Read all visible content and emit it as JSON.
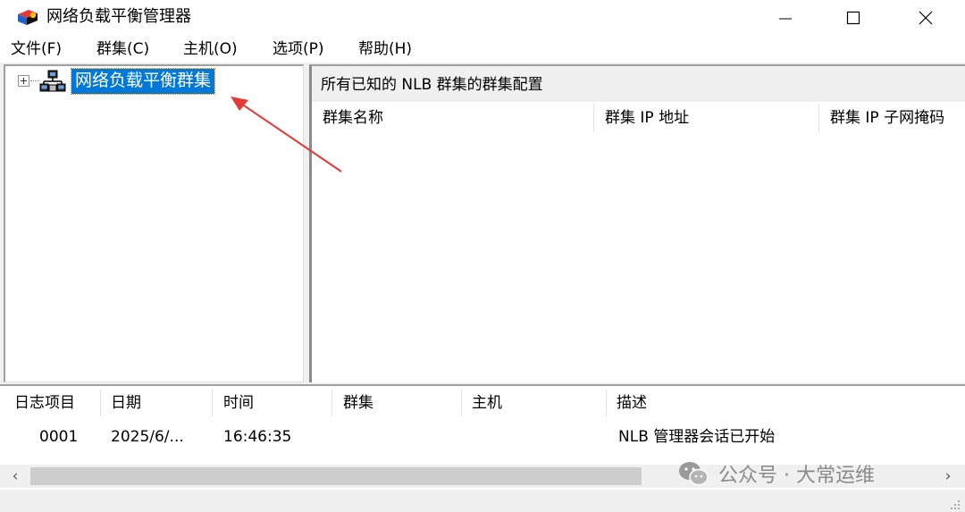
{
  "window": {
    "title": "网络负载平衡管理器",
    "icon": "nlb-manager-icon"
  },
  "menu": [
    {
      "label": "文件(F)"
    },
    {
      "label": "群集(C)"
    },
    {
      "label": "主机(O)"
    },
    {
      "label": "选项(P)"
    },
    {
      "label": "帮助(H)"
    }
  ],
  "tree": {
    "root_label": "网络负载平衡群集",
    "expander": "+",
    "icon": "cluster-network-icon"
  },
  "right_pane": {
    "header": "所有已知的 NLB 群集的群集配置",
    "columns": [
      "群集名称",
      "群集 IP 地址",
      "群集 IP 子网掩码"
    ]
  },
  "log": {
    "columns": [
      "日志项目",
      "日期",
      "时间",
      "群集",
      "主机",
      "描述"
    ],
    "rows": [
      {
        "entry": "0001",
        "date": "2025/6/...",
        "time": "16:46:35",
        "cluster": "",
        "host": "",
        "description": "NLB 管理器会话已开始"
      }
    ]
  },
  "watermark": {
    "text": "公众号 · 大常运维",
    "icon": "wechat-icon"
  },
  "colors": {
    "selection": "#0078d7",
    "annotation_arrow": "#e53935"
  }
}
